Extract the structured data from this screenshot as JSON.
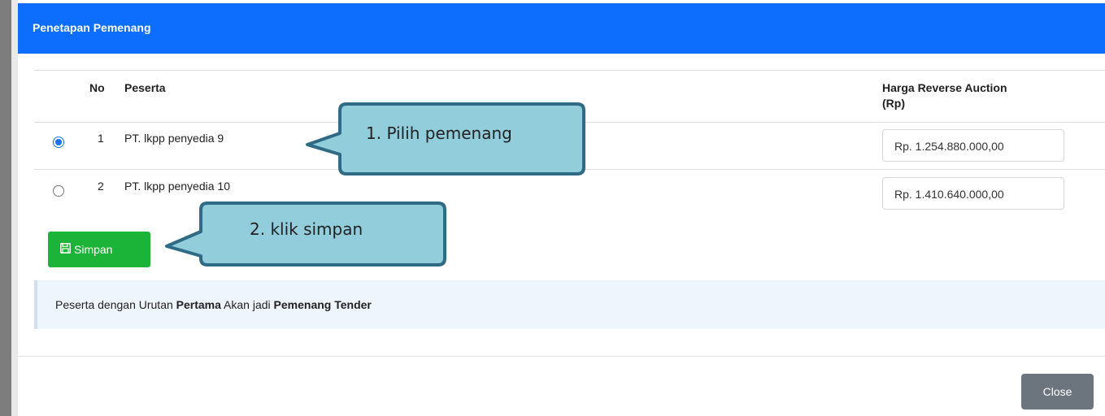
{
  "modal": {
    "title": "Penetapan Pemenang",
    "columns": {
      "no": "No",
      "peserta": "Peserta",
      "harga_line1": "Harga Reverse Auction",
      "harga_line2": "(Rp)"
    },
    "rows": [
      {
        "no": "1",
        "peserta": "PT. lkpp penyedia 9",
        "harga": "Rp. 1.254.880.000,00",
        "selected": true
      },
      {
        "no": "2",
        "peserta": "PT. lkpp penyedia 10",
        "harga": "Rp. 1.410.640.000,00",
        "selected": false
      }
    ],
    "save_button": "Simpan",
    "save_icon": "floppy-disk-icon",
    "info": {
      "prefix": "Peserta dengan Urutan ",
      "bold1": "Pertama",
      "middle": " Akan jadi ",
      "bold2": "Pemenang Tender"
    },
    "close_button": "Close"
  },
  "callouts": {
    "select_winner": "1. Pilih pemenang",
    "click_save": "2. klik simpan"
  },
  "colors": {
    "header_blue": "#0d6efd",
    "save_green": "#1bb338",
    "close_gray": "#6c757d",
    "callout_fill": "#92cddc",
    "callout_border": "#2f6b84",
    "radio_blue": "#1a73e8",
    "info_bg": "#eef5fc"
  }
}
